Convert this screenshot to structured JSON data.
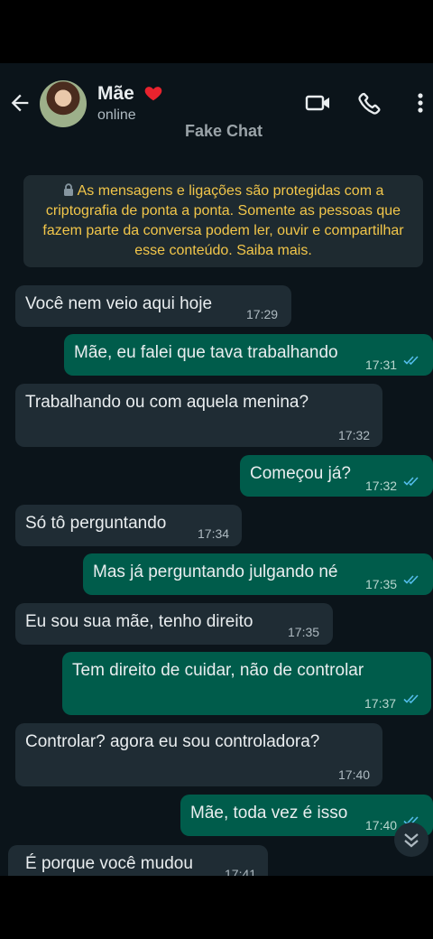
{
  "header": {
    "contact_name": "Mãe",
    "status": "online",
    "watermark": "Fake Chat"
  },
  "notice": {
    "text": "As mensagens e ligações são protegidas com a criptografia de ponta a ponta. Somente as pessoas que fazem parte da conversa podem ler, ouvir e compartilhar esse conteúdo. Saiba mais."
  },
  "messages": [
    {
      "dir": "in",
      "text": "Você nem veio aqui hoje",
      "time": "17:29"
    },
    {
      "dir": "out",
      "text": "Mãe, eu falei que tava trabalhando",
      "time": "17:31"
    },
    {
      "dir": "in",
      "text": "Trabalhando ou com aquela menina?",
      "time": "17:32"
    },
    {
      "dir": "out",
      "text": "Começou já?",
      "time": "17:32"
    },
    {
      "dir": "in",
      "text": "Só tô perguntando",
      "time": "17:34"
    },
    {
      "dir": "out",
      "text": "Mas já perguntando julgando né",
      "time": "17:35"
    },
    {
      "dir": "in",
      "text": "Eu sou sua mãe, tenho direito",
      "time": "17:35"
    },
    {
      "dir": "out",
      "text": "Tem direito de cuidar, não de controlar",
      "time": "17:37"
    },
    {
      "dir": "in",
      "text": "Controlar? agora eu sou controladora?",
      "time": "17:40"
    },
    {
      "dir": "out",
      "text": "Mãe, toda vez é isso",
      "time": "17:40"
    },
    {
      "dir": "in",
      "text": "É porque você mudou",
      "time": "17:41"
    }
  ],
  "colors": {
    "background": "#0b141a",
    "incoming_bubble": "#1f2c34",
    "outgoing_bubble": "#005c4b",
    "read_ticks": "#53bdeb",
    "notice_text": "#f2c64a"
  }
}
